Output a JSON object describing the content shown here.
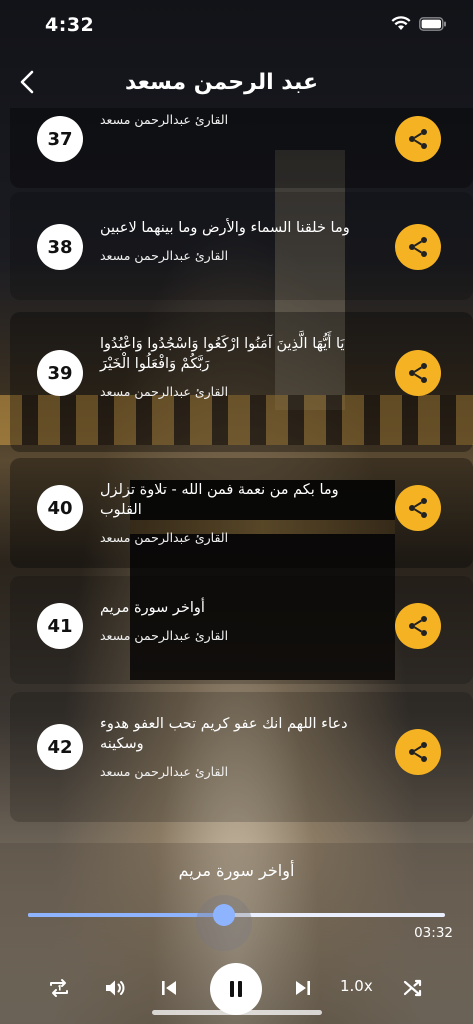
{
  "status_bar": {
    "time": "4:32",
    "icons": [
      "wifi-icon",
      "battery-icon"
    ]
  },
  "header": {
    "title": "عبد الرحمن مسعد",
    "back_icon": "chevron-left-icon"
  },
  "list": {
    "items": [
      {
        "number": "37",
        "title": "",
        "reciter": "القارئ عبدالرحمن مسعد",
        "shade": "dim"
      },
      {
        "number": "38",
        "title": "وما خلقنا السماء والأرض وما بينهما لاعبين",
        "reciter": "القارئ عبدالرحمن مسعد",
        "shade": "light"
      },
      {
        "number": "39",
        "title": "يَا أَيُّهَا الَّذِينَ آمَنُوا ارْكَعُوا وَاسْجُدُوا وَاعْبُدُوا رَبَّكُمْ وَافْعَلُوا الْخَيْرَ",
        "reciter": "القارئ عبدالرحمن مسعد",
        "shade": "dim"
      },
      {
        "number": "40",
        "title": "وما بكم من نعمة فمن الله - تلاوة تزلزل القلوب",
        "reciter": "القارئ عبدالرحمن مسعد",
        "shade": "dim"
      },
      {
        "number": "41",
        "title": "أواخر سورة مريم",
        "reciter": "القارئ عبدالرحمن مسعد",
        "shade": "light"
      },
      {
        "number": "42",
        "title": "دعاء اللهم انك عفو كريم تحب العفو هدوء وسكينه",
        "reciter": "القارئ عبدالرحمن مسعد",
        "shade": "light"
      }
    ]
  },
  "player": {
    "now_playing": "أواخر سورة مريم",
    "duration": "03:32",
    "progress": 0.47,
    "speed": "1.0x",
    "controls": [
      "repeat-one-icon",
      "volume-icon",
      "skip-previous-icon",
      "pause-icon",
      "skip-next-icon",
      "shuffle-icon"
    ]
  },
  "colors": {
    "accent": "#f5b324",
    "progress": "#8fb4ff"
  }
}
